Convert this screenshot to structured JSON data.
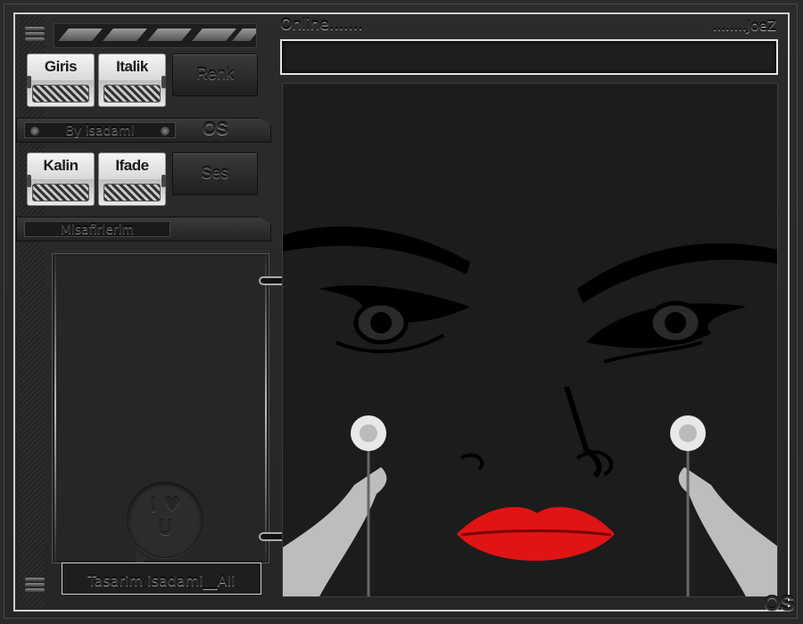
{
  "header": {
    "online_label": "Online.......",
    "nick_label": "........JoeZ"
  },
  "toolbar1": {
    "giris": "Giris",
    "italik": "Italik",
    "renk": "Renk"
  },
  "credit_bar": {
    "label": "By isadami",
    "logo": "OS"
  },
  "toolbar2": {
    "kalin": "Kalin",
    "ifade": "Ifade",
    "ses": "Ses"
  },
  "guests": {
    "title": "Misafirlerim",
    "items": []
  },
  "love_badge": {
    "line1": "I ♥",
    "line2": "U"
  },
  "footer": {
    "credit": "Tasarim isadami__Ali",
    "corner_logo": "OS"
  },
  "colors": {
    "frame": "#cfcfcf",
    "background": "#2a2a2a",
    "lips": "#e01414"
  }
}
